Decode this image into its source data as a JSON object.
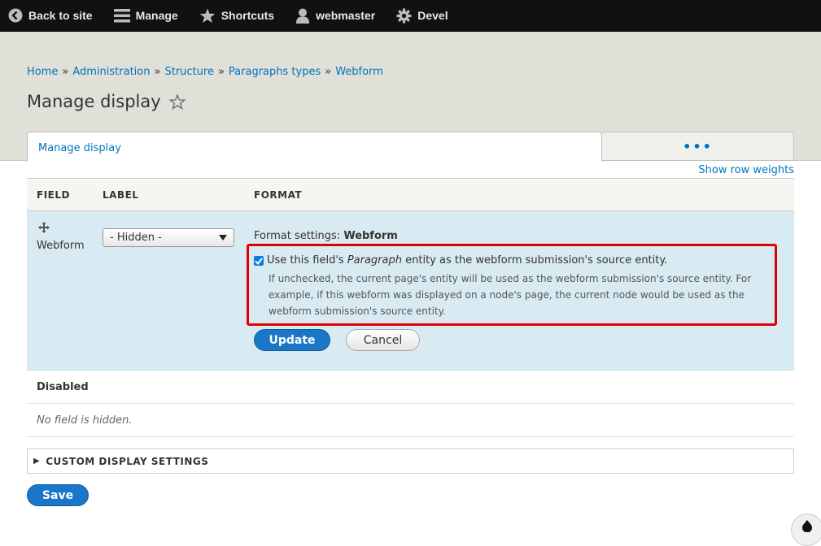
{
  "toolbar": {
    "back_label": "Back to site",
    "manage_label": "Manage",
    "shortcuts_label": "Shortcuts",
    "user_label": "webmaster",
    "devel_label": "Devel"
  },
  "breadcrumb": [
    "Home",
    "Administration",
    "Structure",
    "Paragraphs types",
    "Webform"
  ],
  "breadcrumb_separator": "»",
  "page_title": "Manage display",
  "tabs": {
    "active": "Manage display",
    "more": "•••"
  },
  "show_row_weights": "Show row weights",
  "table": {
    "headers": [
      "FIELD",
      "LABEL",
      "FORMAT"
    ],
    "active_row": {
      "field": "Webform",
      "label_select": "- Hidden -",
      "format_settings_prefix": "Format settings:",
      "format_settings_name": "Webform",
      "checkbox_checked": true,
      "checkbox_label_before": "Use this field's ",
      "checkbox_label_em": "Paragraph",
      "checkbox_label_after": " entity as the webform submission's source entity.",
      "description": "If unchecked, the current page's entity will be used as the webform submission's source entity. For example, if this webform was displayed on a node's page, the current node would be used as the webform submission's source entity.",
      "update_label": "Update",
      "cancel_label": "Cancel"
    },
    "region_label": "Disabled",
    "empty_text": "No field is hidden."
  },
  "custom_display_settings": "CUSTOM DISPLAY SETTINGS",
  "save_label": "Save",
  "colors": {
    "accent": "#0074bd",
    "button_primary": "#1a76c6",
    "highlight": "#e10000",
    "row_active_bg": "#d9ebf2"
  }
}
